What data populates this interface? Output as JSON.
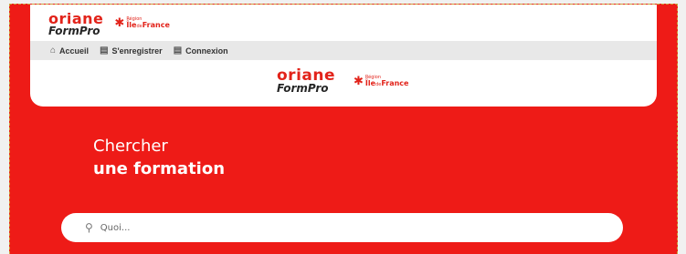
{
  "brand": {
    "name_line1": "oriane",
    "name_line2": "FormPro",
    "region_line1": "Région",
    "region_line2_a": "Île",
    "region_line2_b": "de",
    "region_line2_c": "France"
  },
  "nav": {
    "items": [
      {
        "icon": "home-icon",
        "label": "Accueil"
      },
      {
        "icon": "clipboard-icon",
        "label": "S'enregistrer"
      },
      {
        "icon": "clipboard-icon",
        "label": "Connexion"
      }
    ]
  },
  "hero": {
    "line1": "Chercher",
    "line2": "une formation"
  },
  "search": {
    "placeholder": "Quoi..."
  },
  "colors": {
    "brand_red": "#ee1b17",
    "white": "#ffffff"
  }
}
